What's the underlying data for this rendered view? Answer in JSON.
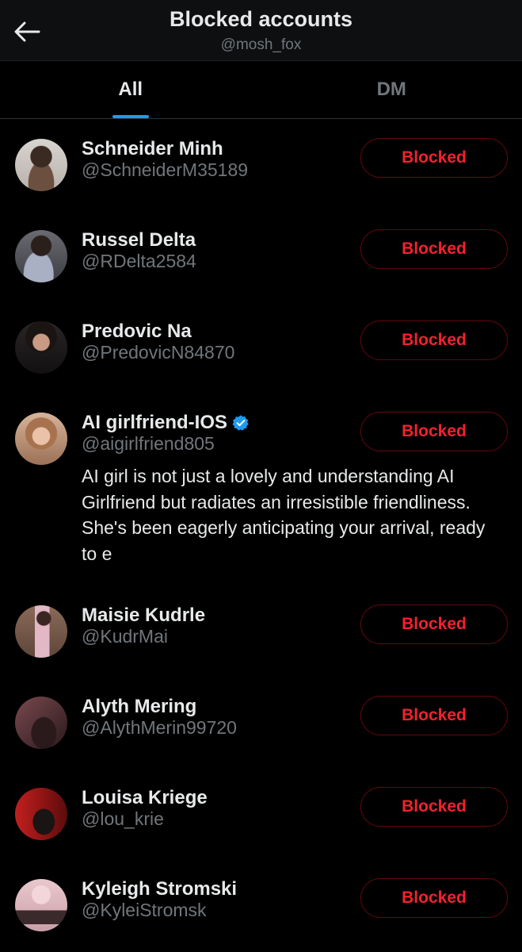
{
  "header": {
    "title": "Blocked accounts",
    "subtitle": "@mosh_fox"
  },
  "tabs": [
    {
      "label": "All",
      "active": true
    },
    {
      "label": "DM",
      "active": false
    }
  ],
  "colors": {
    "background": "#000000",
    "accent_blue": "#1d9bf0",
    "blocked_red": "#f4212e",
    "muted_text": "#71767b"
  },
  "accounts": [
    {
      "name": "Schneider Minh",
      "handle": "@SchneiderM35189",
      "button": "Blocked"
    },
    {
      "name": "Russel Delta",
      "handle": "@RDelta2584",
      "button": "Blocked"
    },
    {
      "name": "Predovic Na",
      "handle": "@PredovicN84870",
      "button": "Blocked"
    },
    {
      "name": "AI girlfriend-IOS",
      "handle": "@aigirlfriend805",
      "verified": true,
      "bio": "AI girl is not just a lovely and understanding AI Girlfriend but radiates an irresistible friendliness. She's been eagerly anticipating your arrival, ready to e",
      "button": "Blocked"
    },
    {
      "name": "Maisie Kudrle",
      "handle": "@KudrMai",
      "button": "Blocked"
    },
    {
      "name": "Alyth Mering",
      "handle": "@AlythMerin99720",
      "button": "Blocked"
    },
    {
      "name": "Louisa Kriege",
      "handle": "@lou_krie",
      "button": "Blocked"
    },
    {
      "name": "Kyleigh Stromski",
      "handle": "@KyleiStromsk",
      "button": "Blocked"
    }
  ]
}
